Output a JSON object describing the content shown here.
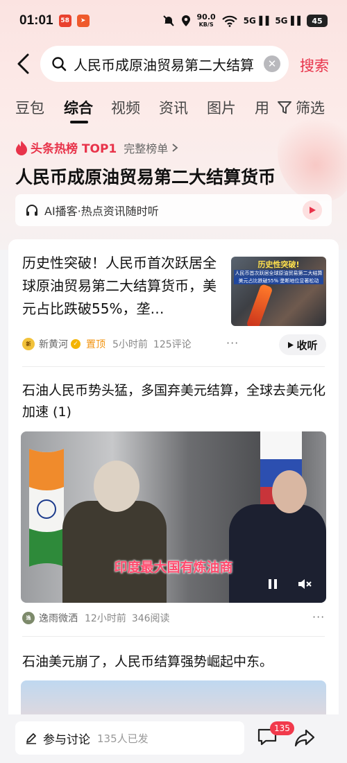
{
  "status_bar": {
    "time": "01:01",
    "app_badge_1": "58",
    "speed_value": "90.0",
    "speed_unit": "KB/S",
    "signal_1": "5G",
    "signal_2": "5G",
    "battery": "45"
  },
  "search": {
    "query": "人民币成原油贸易第二大结算",
    "submit_label": "搜索"
  },
  "tabs": [
    {
      "label": "豆包"
    },
    {
      "label": "综合",
      "active": true
    },
    {
      "label": "视频"
    },
    {
      "label": "资讯"
    },
    {
      "label": "图片"
    },
    {
      "label": "用"
    }
  ],
  "filter_label": "筛选",
  "hot": {
    "label": "头条热榜 TOP1",
    "full_list": "完整榜单",
    "title": "人民币成原油贸易第二大结算货币"
  },
  "ai_podcast": {
    "text": "AI播客·热点资讯随时听"
  },
  "articles": [
    {
      "title": "历史性突破！人民币首次跃居全球原油贸易第二大结算货币，美元占比跌破55%，垄…",
      "thumb_heading": "历史性突破!",
      "thumb_line_1": "人民币首次跃居全球原油贸易第二大结算货币",
      "thumb_line_2": "美元占比跌破55% 垄断地位显著松动",
      "source": "新黄河",
      "pinned": "置顶",
      "time": "5小时前",
      "comments": "125评论",
      "listen": "收听"
    },
    {
      "title": "石油人民币势头猛，多国弃美元结算，全球去美元化加速 (1)",
      "video_subtitle": "印度最大国有炼油商",
      "source": "逸雨微洒",
      "time": "12小时前",
      "reads": "346阅读"
    },
    {
      "title": "石油美元崩了，人民币结算强势崛起中东。"
    }
  ],
  "bottom_bar": {
    "discuss_label": "参与讨论",
    "discuss_count": "135人已发",
    "comment_badge": "135"
  },
  "colors": {
    "accent": "#e8334a",
    "pinned": "#f2930e"
  }
}
